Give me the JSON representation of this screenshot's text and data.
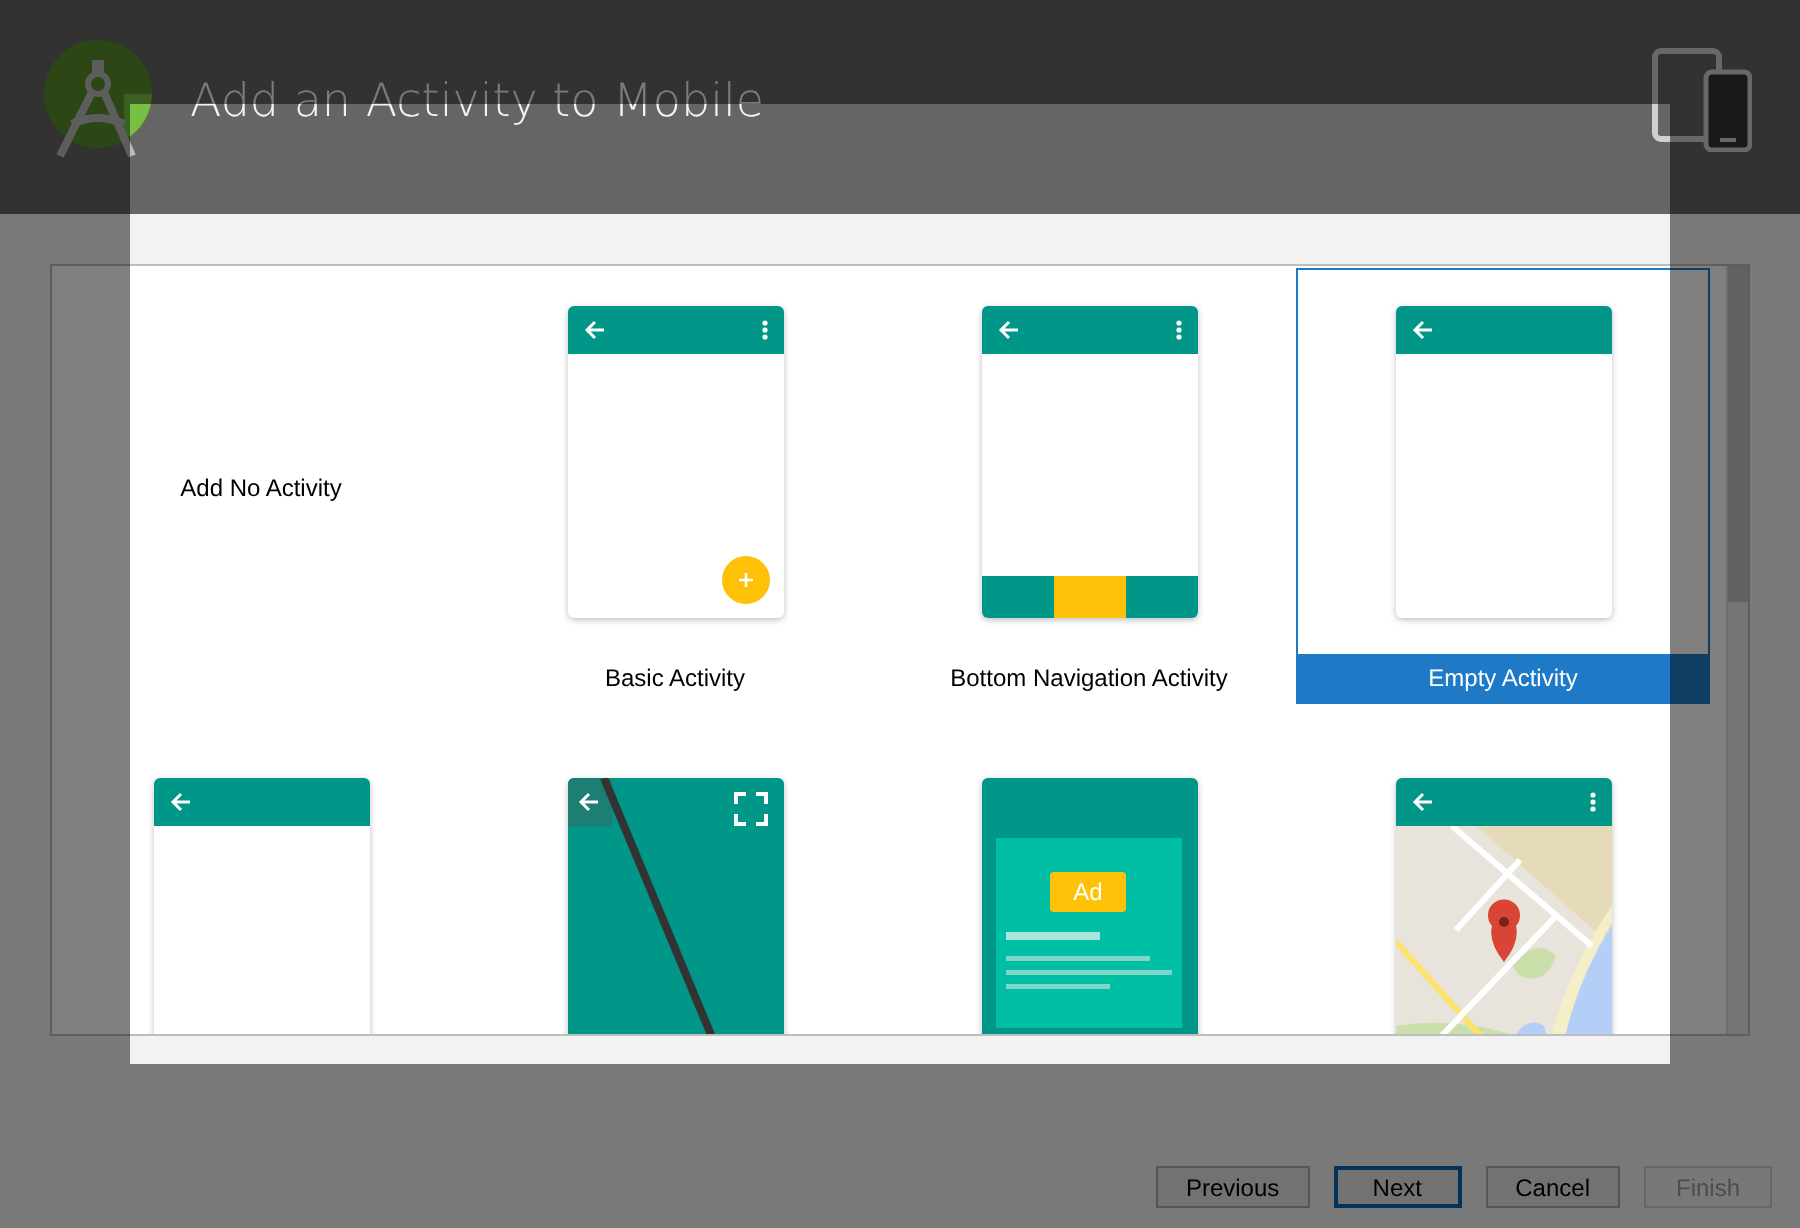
{
  "window": {
    "title": "Add an Activity to Mobile"
  },
  "templates": [
    {
      "kind": "none",
      "label": "Add No Activity",
      "selected": false
    },
    {
      "kind": "basic",
      "label": "Basic Activity",
      "selected": false
    },
    {
      "kind": "bottom_nav",
      "label": "Bottom Navigation Activity",
      "selected": false
    },
    {
      "kind": "empty",
      "label": "Empty Activity",
      "selected": true
    },
    {
      "kind": "empty",
      "selected": false
    },
    {
      "kind": "fullscreen",
      "selected": false
    },
    {
      "kind": "admob",
      "badge": "Ad",
      "selected": false
    },
    {
      "kind": "maps",
      "selected": false
    }
  ],
  "buttons": [
    {
      "label": "Previous",
      "kind": "normal",
      "disabled": false
    },
    {
      "label": "Next",
      "kind": "default",
      "disabled": false
    },
    {
      "label": "Cancel",
      "kind": "normal",
      "disabled": false
    },
    {
      "label": "Finish",
      "kind": "normal",
      "disabled": true
    }
  ]
}
